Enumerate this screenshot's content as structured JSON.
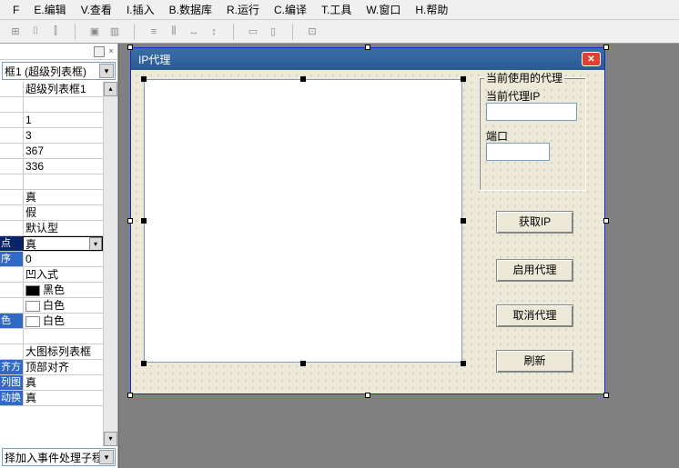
{
  "menu": {
    "items": [
      "F",
      "E.编辑",
      "V.查看",
      "I.插入",
      "B.数据库",
      "R.运行",
      "C.编译",
      "T.工具",
      "W.窗口",
      "H.帮助"
    ]
  },
  "leftpanel": {
    "combo_top": "框1 (超级列表框)",
    "props": [
      {
        "label": "",
        "value": "超级列表框1"
      },
      {
        "label": "",
        "value": ""
      },
      {
        "label": "",
        "value": "1"
      },
      {
        "label": "",
        "value": "3"
      },
      {
        "label": "",
        "value": "367"
      },
      {
        "label": "",
        "value": "336"
      },
      {
        "label": "",
        "value": ""
      },
      {
        "label": "",
        "value": "真"
      },
      {
        "label": "",
        "value": "假"
      },
      {
        "label": "",
        "value": "默认型"
      },
      {
        "label": "点",
        "value": "真",
        "sel": true,
        "dd": true
      },
      {
        "label": "序",
        "value": "0",
        "selLight": true
      },
      {
        "label": "",
        "value": "凹入式"
      },
      {
        "label": "",
        "swatch": "#000000",
        "value": "黑色"
      },
      {
        "label": "",
        "swatch": "#ffffff",
        "value": "白色"
      },
      {
        "label": "色",
        "swatch": "#ffffff",
        "value": "白色",
        "selLight": true
      },
      {
        "label": "",
        "value": ""
      },
      {
        "label": "",
        "value": "大图标列表框"
      },
      {
        "label": "齐方",
        "value": "顶部对齐",
        "selLight": true
      },
      {
        "label": "列图",
        "value": "真",
        "selLight": true
      },
      {
        "label": "动换",
        "value": "真",
        "selLight": true
      }
    ],
    "combo_bottom": "择加入事件处理子程"
  },
  "form": {
    "title": "IP代理",
    "groupbox": {
      "legend": "当前使用的代理",
      "ip_label": "当前代理IP",
      "port_label": "端口"
    },
    "buttons": {
      "get_ip": "获取IP",
      "enable": "启用代理",
      "disable": "取消代理",
      "refresh": "刷新"
    }
  }
}
